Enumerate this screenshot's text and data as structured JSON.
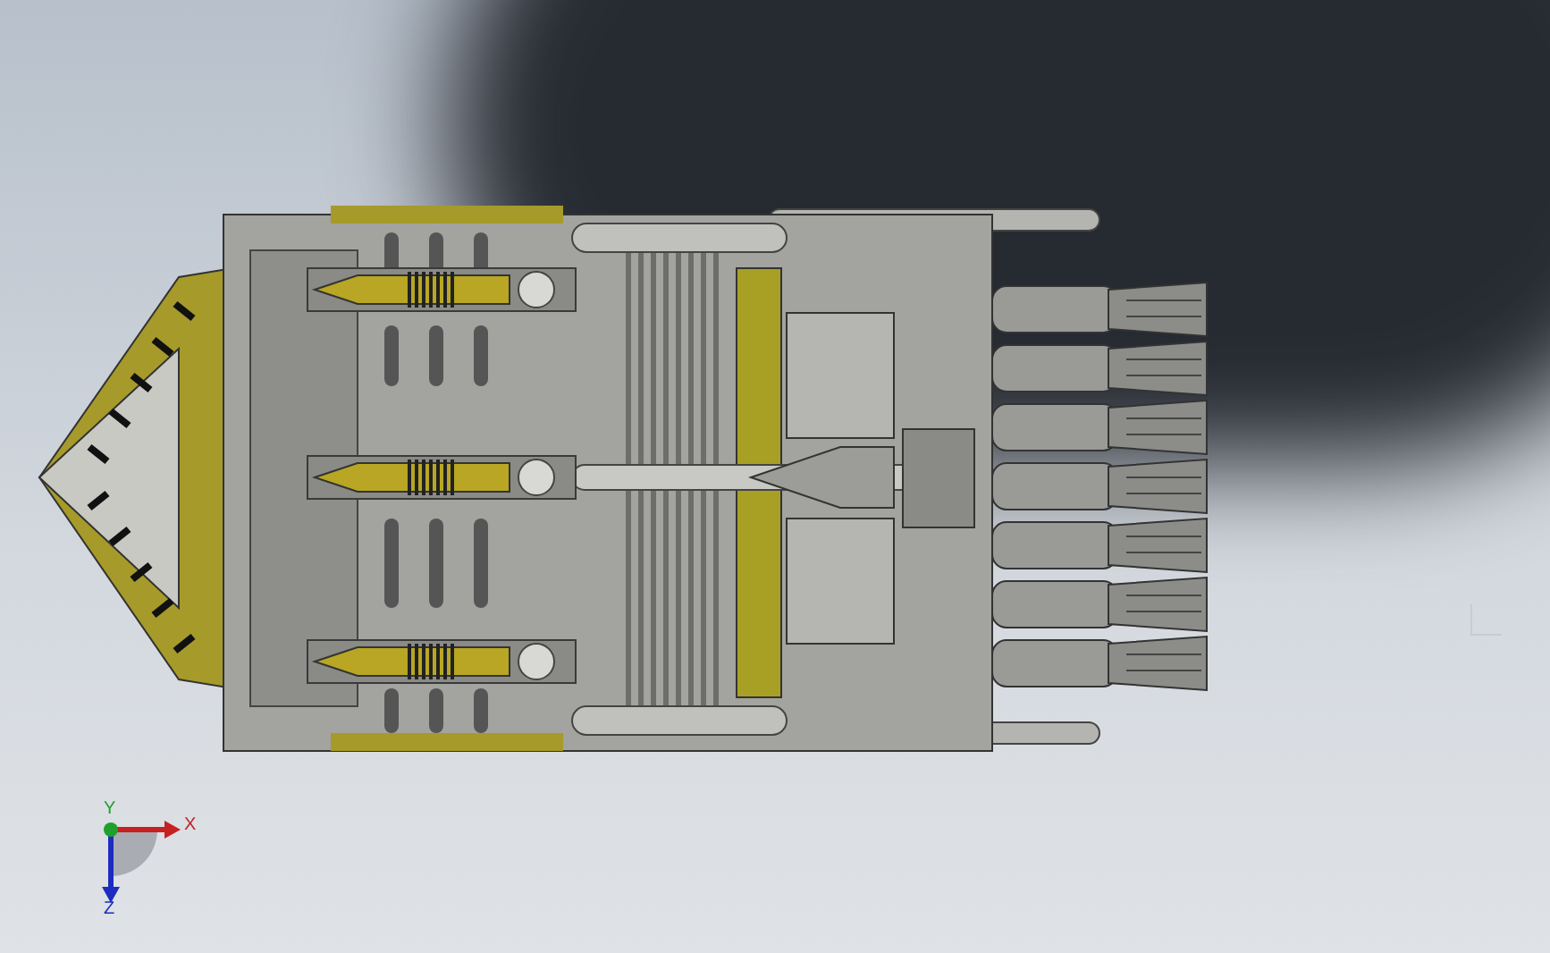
{
  "viewport": {
    "triad": {
      "x_label": "X",
      "y_label": "Y",
      "z_label": "Z"
    }
  }
}
